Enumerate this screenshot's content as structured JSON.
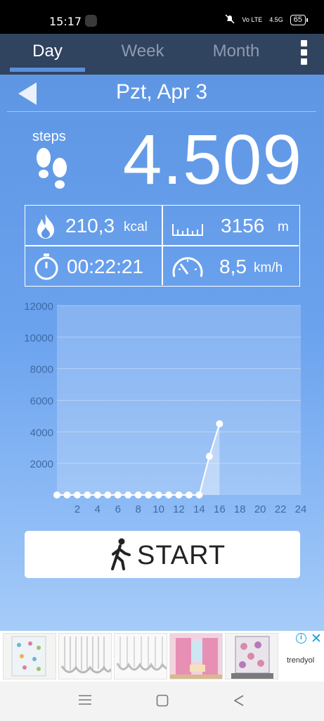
{
  "status_bar": {
    "time": "15:17",
    "network": "Vo LTE",
    "signal": "4.5G",
    "battery": "65"
  },
  "tabs": [
    {
      "label": "Day",
      "active": true
    },
    {
      "label": "Week",
      "active": false
    },
    {
      "label": "Month",
      "active": false
    }
  ],
  "day": {
    "date": "Pzt, Apr 3",
    "steps_label": "steps",
    "steps": "4.509"
  },
  "stats": {
    "calories": {
      "value": "210,3",
      "unit": "kcal",
      "icon": "flame-icon"
    },
    "distance": {
      "value": "3156",
      "unit": "m",
      "icon": "ruler-icon"
    },
    "duration": {
      "value": "00:22:21",
      "icon": "stopwatch-icon"
    },
    "speed": {
      "value": "8,5",
      "unit": "km/h",
      "icon": "speedometer-icon"
    }
  },
  "start_button": {
    "label": "START",
    "icon": "walking-person-icon"
  },
  "ad": {
    "brand": "trendyol",
    "info_icon": "info-icon",
    "close_icon": "close-icon"
  },
  "colors": {
    "header": "#30435f",
    "accent": "#5b8fe0",
    "background": "#5e96e4"
  },
  "chart_data": {
    "type": "line",
    "y_ticks": [
      "12000",
      "10000",
      "8000",
      "6000",
      "4000",
      "2000"
    ],
    "x_ticks": [
      "2",
      "4",
      "6",
      "8",
      "10",
      "12",
      "14",
      "16",
      "18",
      "20",
      "22",
      "24"
    ],
    "ylim": [
      0,
      12000
    ],
    "xlim": [
      0,
      24
    ],
    "x": [
      0,
      1,
      2,
      3,
      4,
      5,
      6,
      7,
      8,
      9,
      10,
      11,
      12,
      13,
      14,
      15,
      16
    ],
    "values": [
      0,
      0,
      0,
      0,
      0,
      0,
      0,
      0,
      0,
      0,
      0,
      0,
      0,
      0,
      0,
      2450,
      4509
    ],
    "grid": true
  }
}
